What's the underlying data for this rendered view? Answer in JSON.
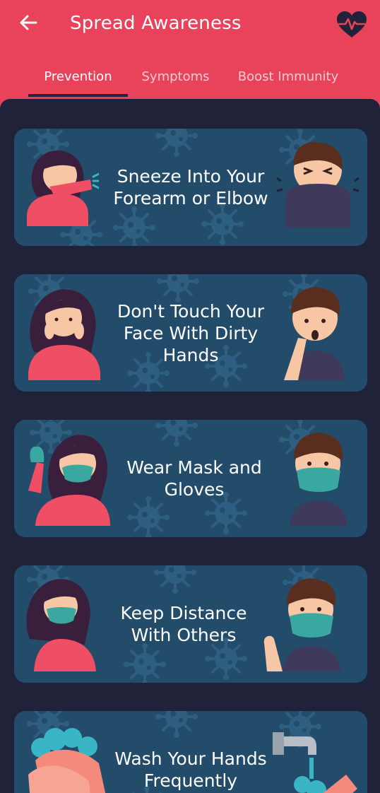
{
  "app_bar": {
    "title": "Spread Awareness",
    "back_icon": "arrow-left-icon",
    "action_icon": "heart-pulse-icon",
    "background": "#e9435b"
  },
  "tabs": [
    {
      "label": "Prevention",
      "active": true
    },
    {
      "label": "Symptoms",
      "active": false
    },
    {
      "label": "Boost Immunity",
      "active": false
    }
  ],
  "cards": [
    {
      "text": "Sneeze Into Your Forearm or Elbow"
    },
    {
      "text": "Don't Touch Your Face With Dirty Hands"
    },
    {
      "text": "Wear Mask and Gloves"
    },
    {
      "text": "Keep Distance With Others"
    },
    {
      "text": "Wash Your Hands Frequently"
    }
  ],
  "colors": {
    "content_bg": "#1f2238",
    "card_bg": "#234b6a",
    "mask": "#3aa8a0",
    "shirt_female": "#ef4f64",
    "skin": "#f6c6a5"
  }
}
